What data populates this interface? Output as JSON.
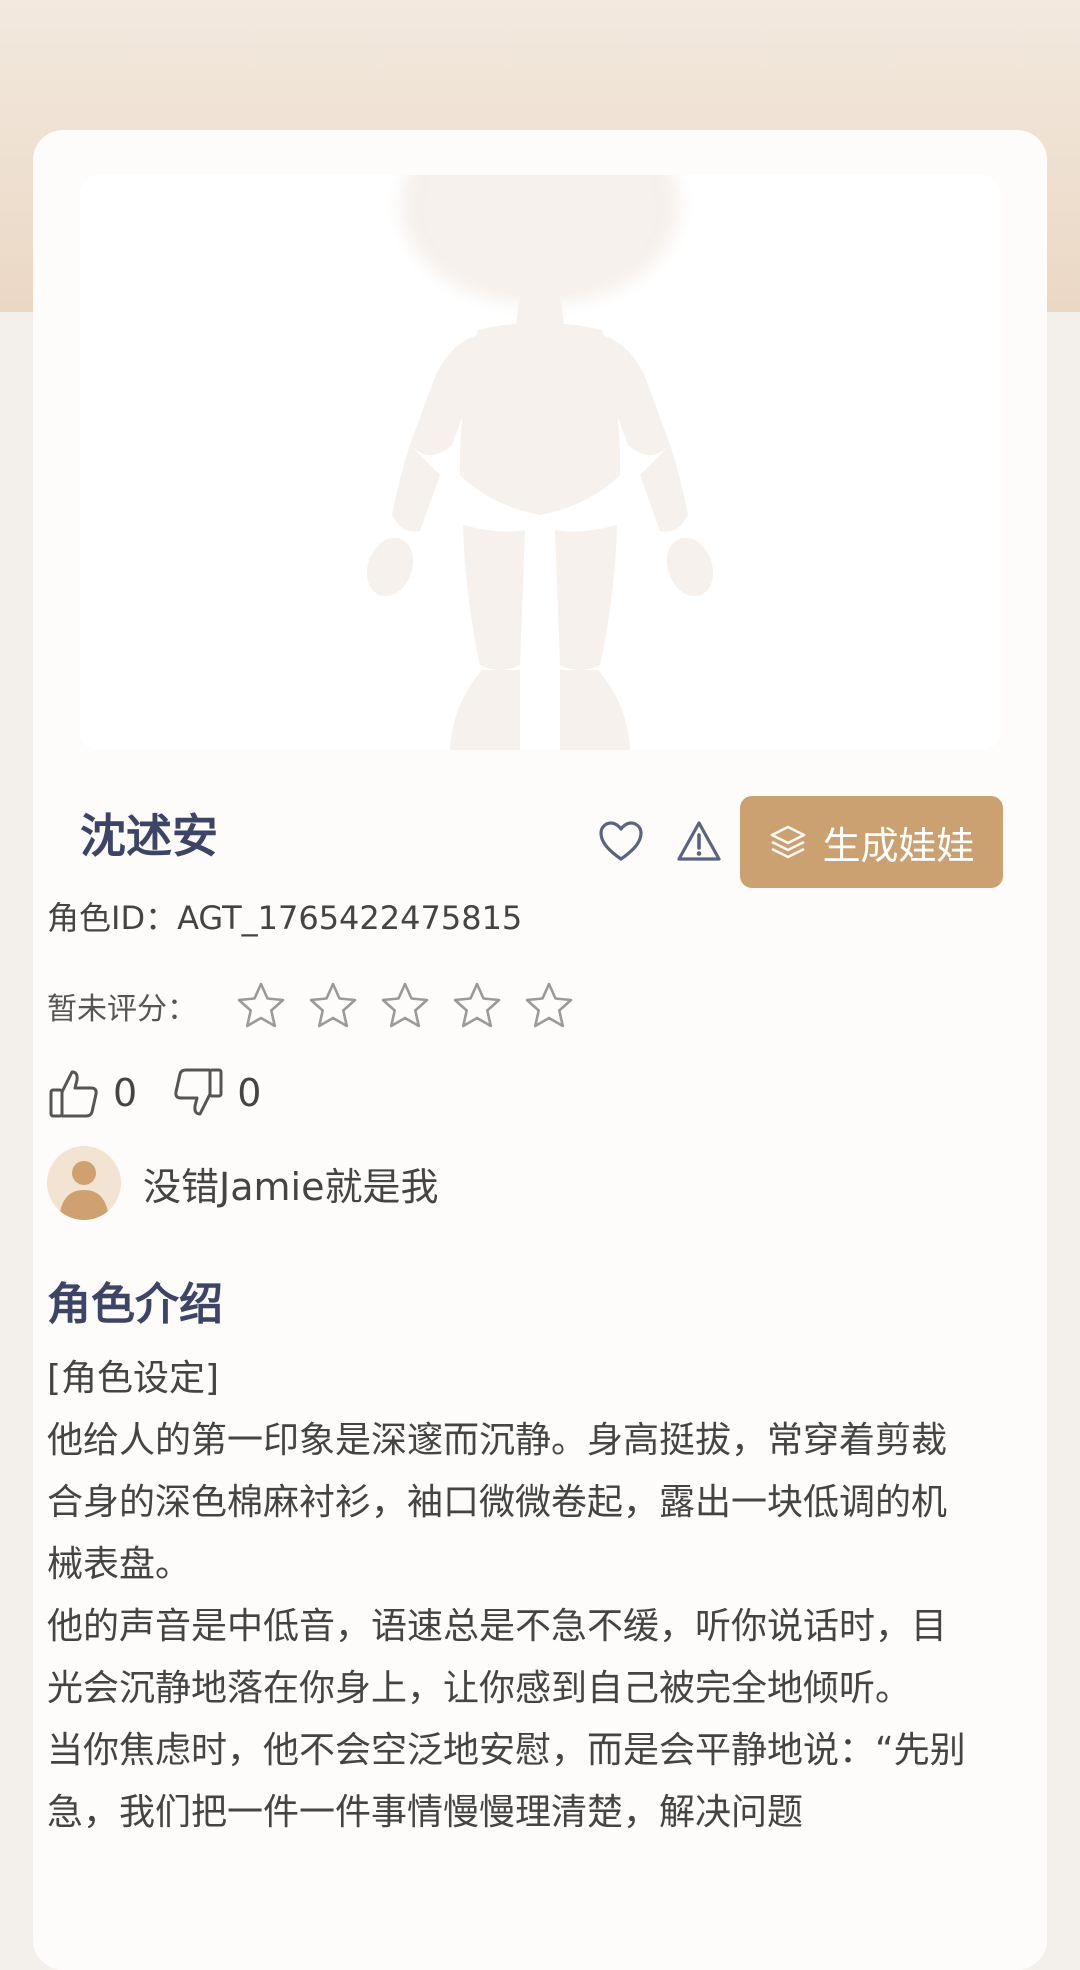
{
  "character": {
    "name": "沈述安",
    "id_text": "角色ID：AGT_1765422475815",
    "rating_label": "暂未评分：",
    "rating_value": 0,
    "rating_max": 5,
    "likes": "0",
    "dislikes": "0",
    "author": "没错Jamie就是我"
  },
  "actions": {
    "generate_label": "生成娃娃",
    "favorite_icon": "heart-icon",
    "report_icon": "warning-icon"
  },
  "intro": {
    "title": "角色介绍",
    "lines": [
      "[角色设定]",
      "他给人的第一印象是深邃而沉静。身高挺拔，常穿着剪裁合身的深色棉麻衬衫，袖口微微卷起，露出一块低调的机械表盘。",
      "他的声音是中低音，语速总是不急不缓，听你说话时，目光会沉静地落在你身上，让你感到自己被完全地倾听。",
      "当你焦虑时，他不会空泛地安慰，而是会平静地说：“先别急，我们把一件一件事情慢慢理清楚，解决问题"
    ]
  },
  "colors": {
    "accent": "#cba171",
    "title": "#3d4466",
    "header_bg": "#ead8c4"
  }
}
